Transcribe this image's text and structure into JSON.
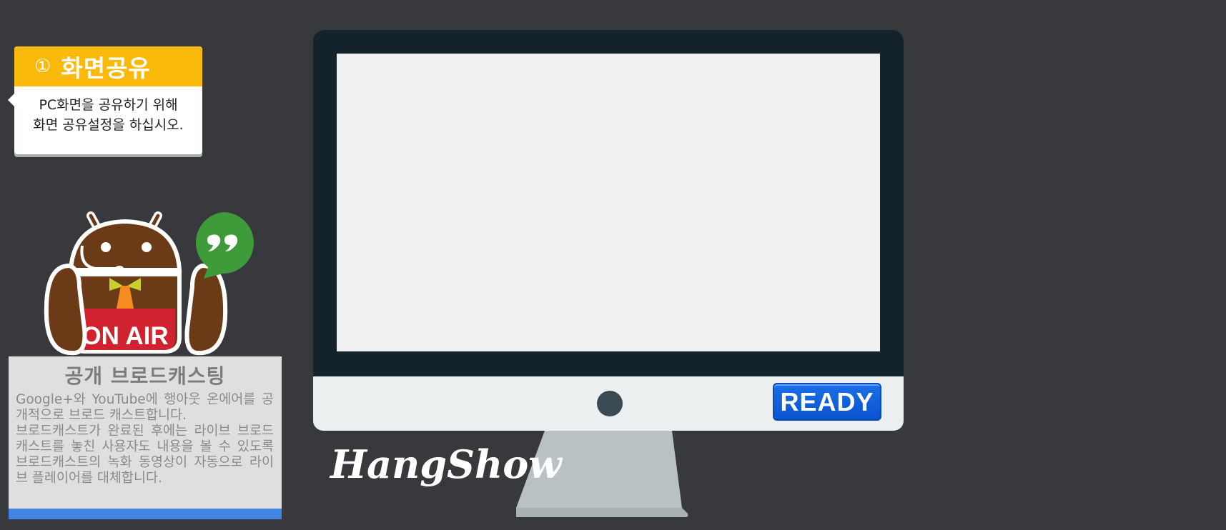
{
  "step": {
    "number": "①",
    "title": "화면공유",
    "line1": "PC화면을 공유하기 위해",
    "line2": "화면 공유설정을 하십시오."
  },
  "mascot": {
    "badge_text": "ON AIR",
    "chat_icon": "hangouts-quote-icon"
  },
  "info": {
    "title": "공개 브로드캐스팅",
    "para1": "Google+와 YouTube에 행아웃 온에어를 공개적으로 브로드 캐스트합니다.",
    "para2": "브로드캐스트가 완료된 후에는 라이브 브로드캐스트를 놓친 사용자도 내용을 볼 수 있도록 브로드캐스트의 녹화 동영상이 자동으로 라이브 플레이어를 대체합니다."
  },
  "monitor": {
    "ready_label": "READY"
  },
  "brand": {
    "name": "HangShow"
  },
  "colors": {
    "background": "#38393c",
    "step_header": "#fbb90b",
    "ready_button": "#0a5bd8",
    "info_bar": "#4185e0",
    "android_brown": "#6b3a17",
    "hangouts_green": "#3f9a3a",
    "on_air_red": "#d0232f"
  }
}
